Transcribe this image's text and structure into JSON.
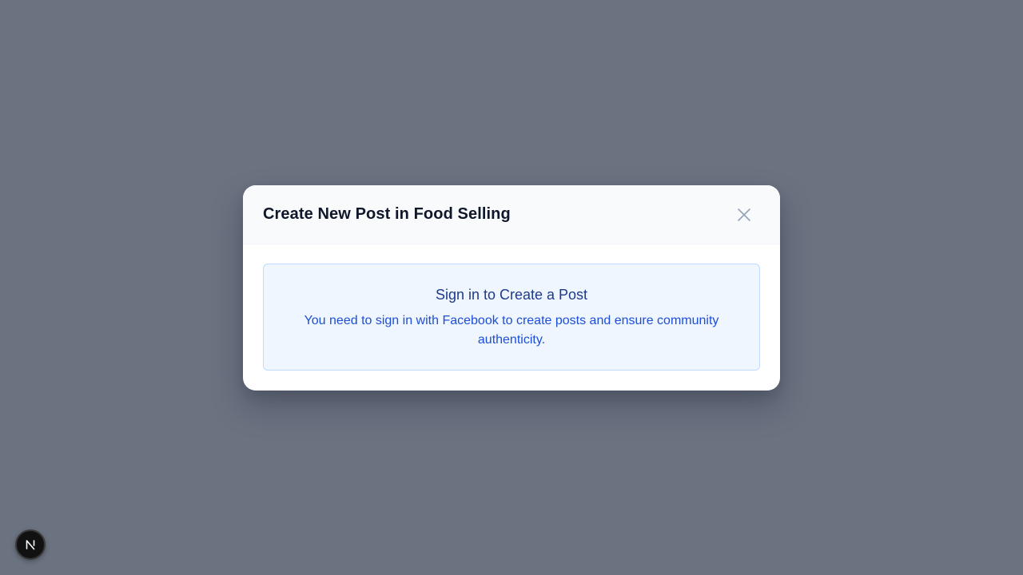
{
  "modal": {
    "title": "Create New Post in Food Selling",
    "close_icon": "close-icon"
  },
  "notice": {
    "title": "Sign in to Create a Post",
    "message": "You need to sign in with Facebook to create posts and ensure community authenticity."
  },
  "dev_badge": {
    "icon": "nextjs-logo-icon",
    "letter": "N"
  },
  "colors": {
    "backdrop": "#6b7280",
    "modal_header": "#f8fafc",
    "title_text": "#0f172a",
    "notice_bg": "#eff6ff",
    "notice_border": "#bfdbfe",
    "notice_title": "#1e3a8a",
    "notice_text": "#1d4ed8"
  }
}
